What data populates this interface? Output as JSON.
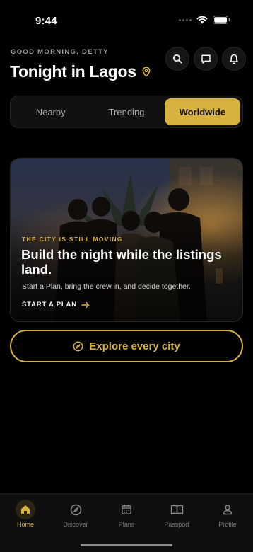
{
  "status": {
    "time": "9:44"
  },
  "header": {
    "greeting": "GOOD MORNING, DETTY",
    "title": "Tonight in Lagos",
    "actions": [
      "search-icon",
      "chat-icon",
      "bell-icon"
    ]
  },
  "filters": {
    "tabs": [
      {
        "label": "Nearby"
      },
      {
        "label": "Trending"
      },
      {
        "label": "Worldwide"
      }
    ],
    "selected": "Worldwide"
  },
  "hero": {
    "eyebrow": "THE CITY IS STILL MOVING",
    "title": "Build the night while the listings land.",
    "subtitle": "Start a Plan, bring the crew in, and decide together.",
    "cta": "START A PLAN"
  },
  "explore": {
    "label": "Explore every city"
  },
  "tabbar": {
    "items": [
      {
        "label": "Home",
        "icon": "home-icon"
      },
      {
        "label": "Discover",
        "icon": "compass-icon"
      },
      {
        "label": "Plans",
        "icon": "calendar-icon"
      },
      {
        "label": "Passport",
        "icon": "book-icon"
      },
      {
        "label": "Profile",
        "icon": "person-icon"
      }
    ],
    "active": "Home"
  },
  "colors": {
    "accent": "#d8b23e",
    "background": "#000000",
    "surface": "#111111"
  }
}
